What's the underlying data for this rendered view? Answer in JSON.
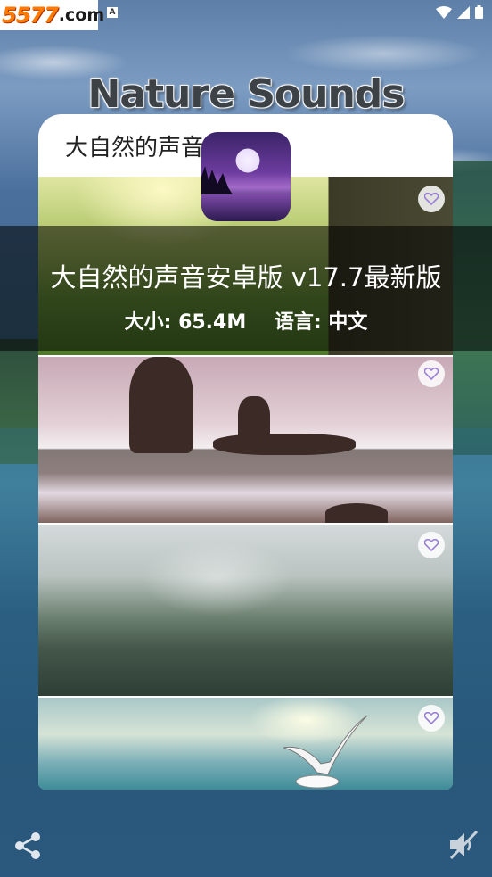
{
  "status_bar": {
    "brand_number": "5577",
    "brand_domain": ".com",
    "notification_icon_letter": "A",
    "icons": [
      "wifi-icon",
      "signal-icon",
      "battery-icon"
    ]
  },
  "app": {
    "title": "Nature Sounds",
    "card_header": "大自然的声音"
  },
  "banner": {
    "title": "大自然的声音安卓版  v17.7最新版",
    "size_label": "大小: 65.4M",
    "language_label": "语言: 中文"
  },
  "tiles": [
    {
      "name": "sunny-meadow",
      "favorite_icon": "heart-icon"
    },
    {
      "name": "ocean-rocks",
      "favorite_icon": "heart-icon"
    },
    {
      "name": "misty-river",
      "favorite_icon": "heart-icon"
    },
    {
      "name": "seagull-waves",
      "favorite_icon": "heart-icon"
    }
  ],
  "bottom_bar": {
    "left_icon": "share-icon",
    "right_icon": "mute-icon"
  },
  "colors": {
    "brand_orange": "#ff7a00",
    "card_bg": "#ffffff",
    "banner_overlay": "rgba(0,0,0,0.55)",
    "heart_purple": "#9b7fd6"
  }
}
